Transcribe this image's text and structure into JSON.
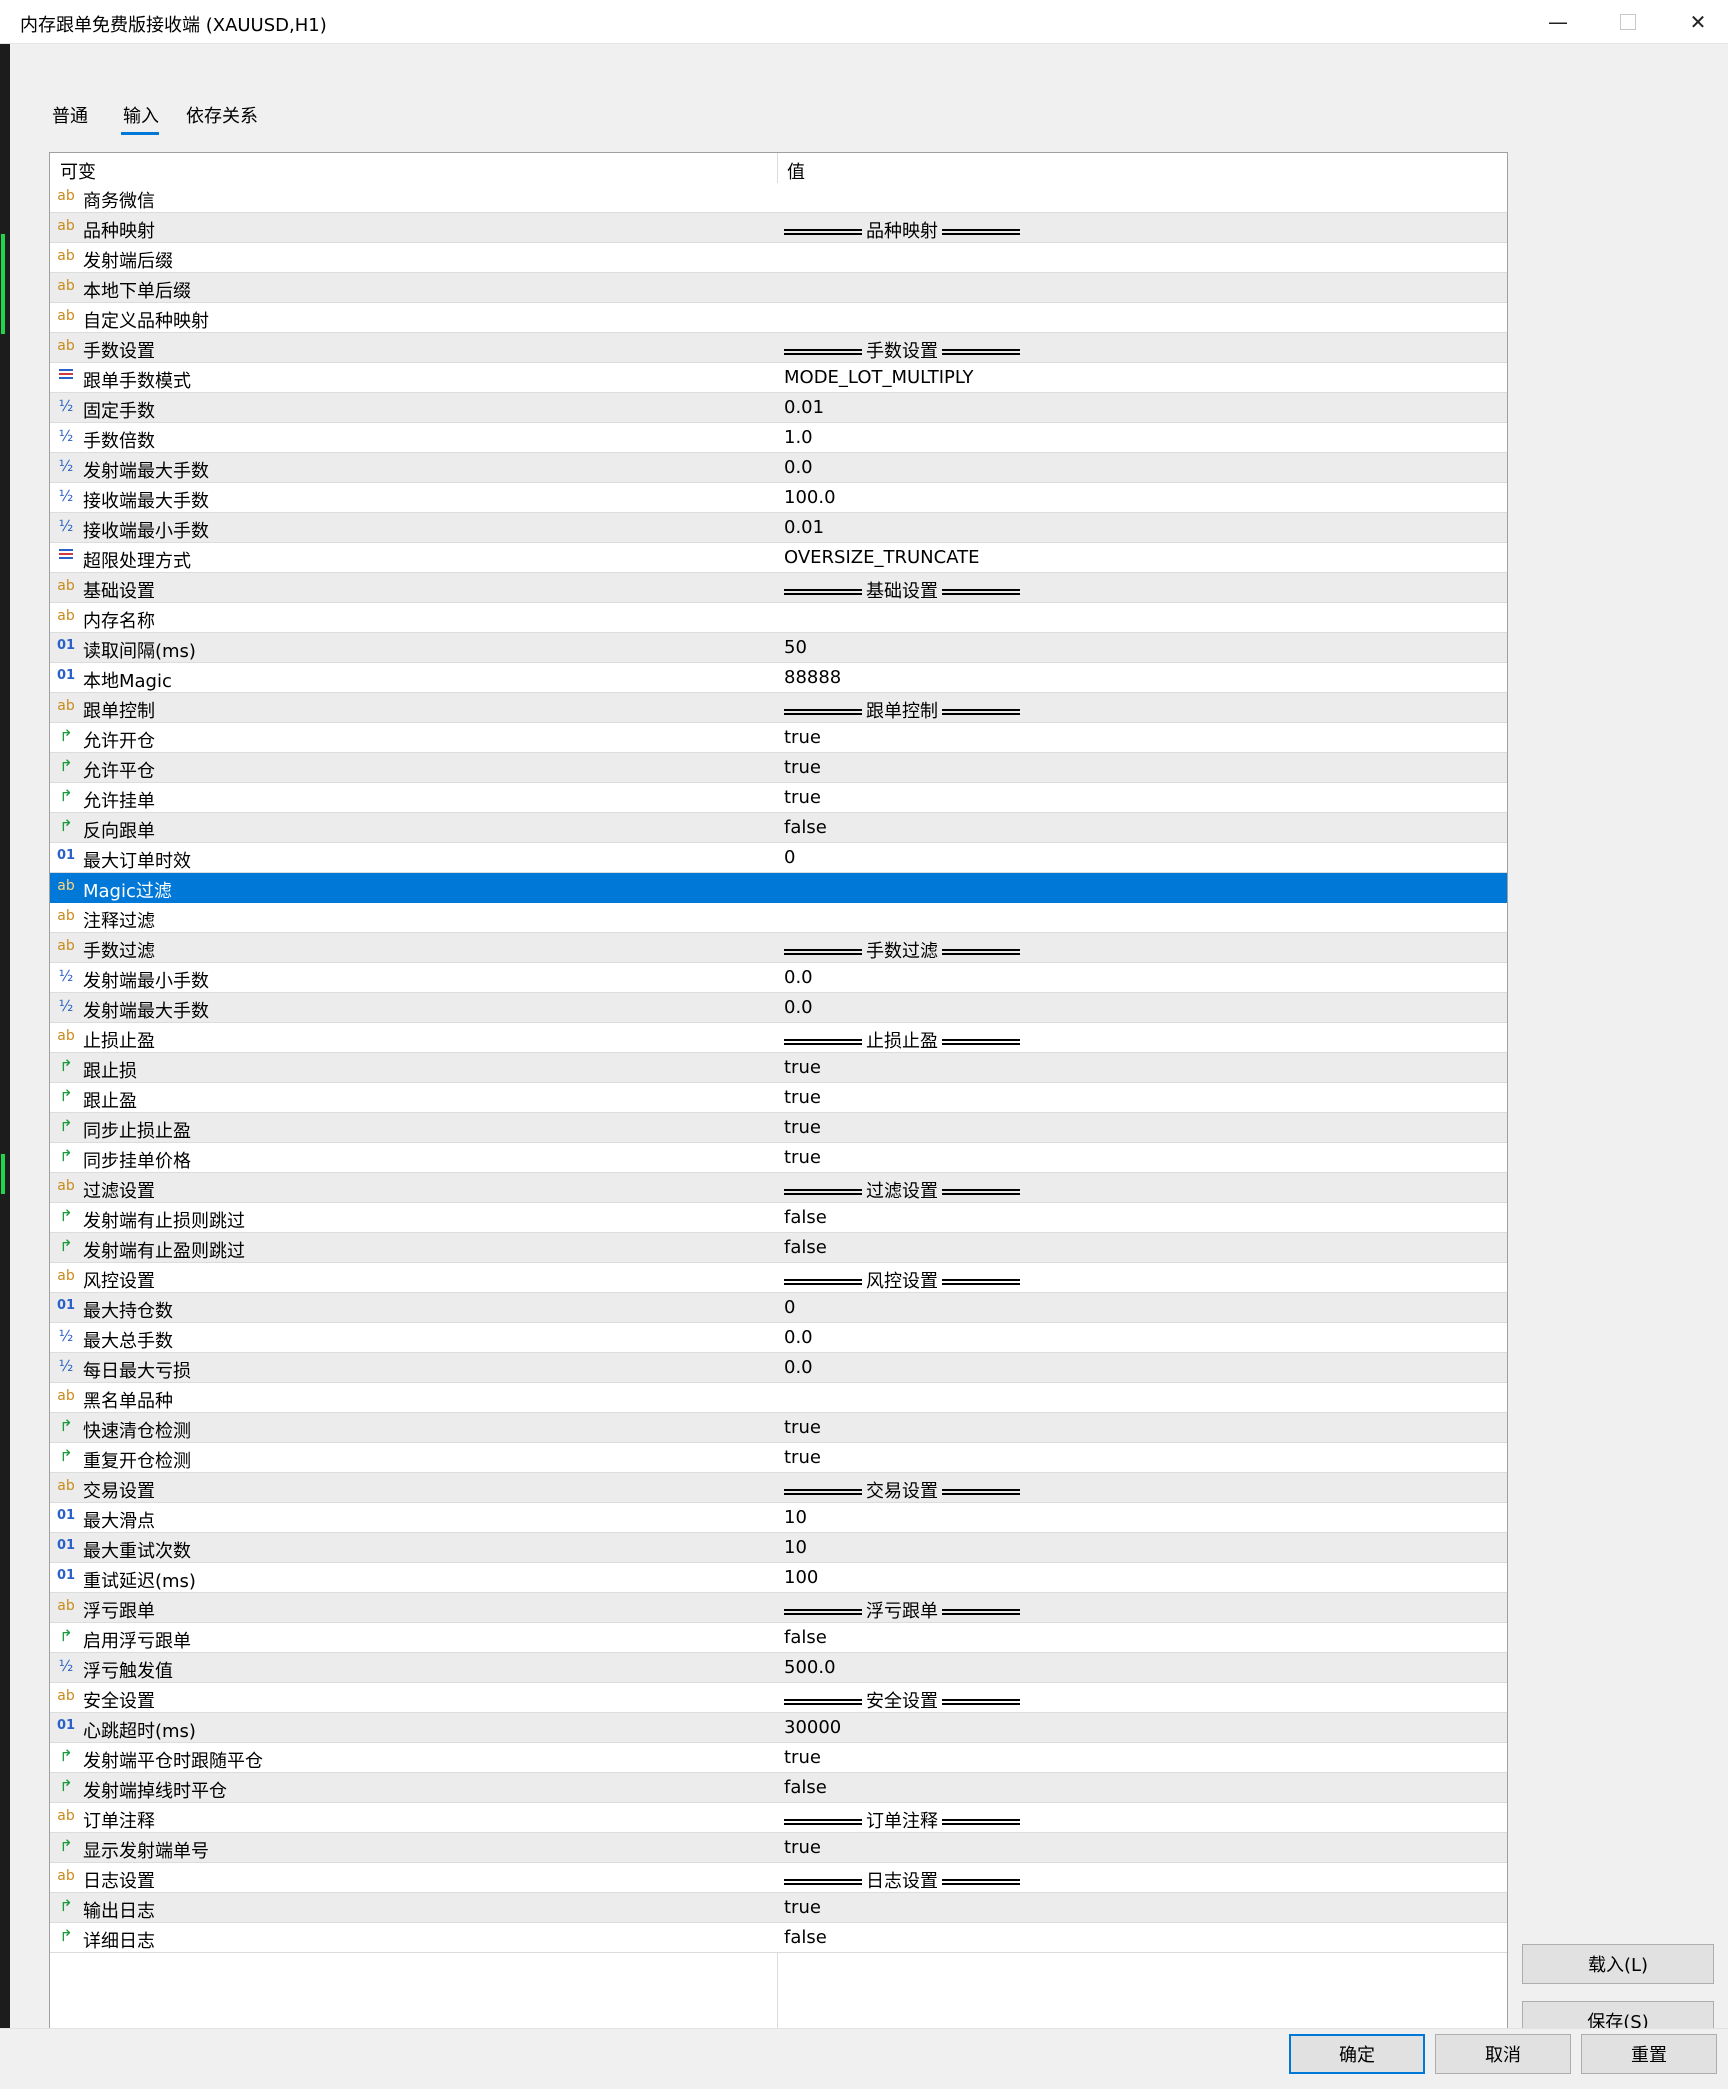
{
  "window": {
    "title": "内存跟单免费版接收端 (XAUUSD,H1)",
    "minimize": "—",
    "close": "✕"
  },
  "tabs": [
    {
      "label": "普通"
    },
    {
      "label": "输入"
    },
    {
      "label": "依存关系"
    }
  ],
  "grid": {
    "col_name": "可变",
    "col_value": "值",
    "rows": [
      {
        "type": "str",
        "name": "商务微信",
        "value": ""
      },
      {
        "type": "str",
        "name": "品种映射",
        "value": "品种映射",
        "section": true
      },
      {
        "type": "str",
        "name": "发射端后缀",
        "value": ""
      },
      {
        "type": "str",
        "name": "本地下单后缀",
        "value": ""
      },
      {
        "type": "str",
        "name": "自定义品种映射",
        "value": ""
      },
      {
        "type": "str",
        "name": "手数设置",
        "value": "手数设置",
        "section": true
      },
      {
        "type": "enum",
        "name": "跟单手数模式",
        "value": "MODE_LOT_MULTIPLY"
      },
      {
        "type": "frac",
        "name": "固定手数",
        "value": "0.01"
      },
      {
        "type": "frac",
        "name": "手数倍数",
        "value": "1.0"
      },
      {
        "type": "frac",
        "name": "发射端最大手数",
        "value": "0.0"
      },
      {
        "type": "frac",
        "name": "接收端最大手数",
        "value": "100.0"
      },
      {
        "type": "frac",
        "name": "接收端最小手数",
        "value": "0.01"
      },
      {
        "type": "enum",
        "name": "超限处理方式",
        "value": "OVERSIZE_TRUNCATE"
      },
      {
        "type": "str",
        "name": "基础设置",
        "value": "基础设置",
        "section": true
      },
      {
        "type": "str",
        "name": "内存名称",
        "value": ""
      },
      {
        "type": "num",
        "name": "读取间隔(ms)",
        "value": "50"
      },
      {
        "type": "num",
        "name": "本地Magic",
        "value": "88888"
      },
      {
        "type": "str",
        "name": "跟单控制",
        "value": "跟单控制",
        "section": true
      },
      {
        "type": "bool",
        "name": "允许开仓",
        "value": "true"
      },
      {
        "type": "bool",
        "name": "允许平仓",
        "value": "true"
      },
      {
        "type": "bool",
        "name": "允许挂单",
        "value": "true"
      },
      {
        "type": "bool",
        "name": "反向跟单",
        "value": "false"
      },
      {
        "type": "num",
        "name": "最大订单时效",
        "value": "0"
      },
      {
        "type": "str",
        "name": "Magic过滤",
        "value": "",
        "selected": true
      },
      {
        "type": "str",
        "name": "注释过滤",
        "value": ""
      },
      {
        "type": "str",
        "name": "手数过滤",
        "value": "手数过滤",
        "section": true
      },
      {
        "type": "frac",
        "name": "发射端最小手数",
        "value": "0.0"
      },
      {
        "type": "frac",
        "name": "发射端最大手数",
        "value": "0.0"
      },
      {
        "type": "str",
        "name": "止损止盈",
        "value": "止损止盈",
        "section": true
      },
      {
        "type": "bool",
        "name": "跟止损",
        "value": "true"
      },
      {
        "type": "bool",
        "name": "跟止盈",
        "value": "true"
      },
      {
        "type": "bool",
        "name": "同步止损止盈",
        "value": "true"
      },
      {
        "type": "bool",
        "name": "同步挂单价格",
        "value": "true"
      },
      {
        "type": "str",
        "name": "过滤设置",
        "value": "过滤设置",
        "section": true
      },
      {
        "type": "bool",
        "name": "发射端有止损则跳过",
        "value": "false"
      },
      {
        "type": "bool",
        "name": "发射端有止盈则跳过",
        "value": "false"
      },
      {
        "type": "str",
        "name": "风控设置",
        "value": "风控设置",
        "section": true
      },
      {
        "type": "num",
        "name": "最大持仓数",
        "value": "0"
      },
      {
        "type": "frac",
        "name": "最大总手数",
        "value": "0.0"
      },
      {
        "type": "frac",
        "name": "每日最大亏损",
        "value": "0.0"
      },
      {
        "type": "str",
        "name": "黑名单品种",
        "value": ""
      },
      {
        "type": "bool",
        "name": "快速清仓检测",
        "value": "true"
      },
      {
        "type": "bool",
        "name": "重复开仓检测",
        "value": "true"
      },
      {
        "type": "str",
        "name": "交易设置",
        "value": "交易设置",
        "section": true
      },
      {
        "type": "num",
        "name": "最大滑点",
        "value": "10"
      },
      {
        "type": "num",
        "name": "最大重试次数",
        "value": "10"
      },
      {
        "type": "num",
        "name": "重试延迟(ms)",
        "value": "100"
      },
      {
        "type": "str",
        "name": "浮亏跟单",
        "value": "浮亏跟单",
        "section": true
      },
      {
        "type": "bool",
        "name": "启用浮亏跟单",
        "value": "false"
      },
      {
        "type": "frac",
        "name": "浮亏触发值",
        "value": "500.0"
      },
      {
        "type": "str",
        "name": "安全设置",
        "value": "安全设置",
        "section": true
      },
      {
        "type": "num",
        "name": "心跳超时(ms)",
        "value": "30000"
      },
      {
        "type": "bool",
        "name": "发射端平仓时跟随平仓",
        "value": "true"
      },
      {
        "type": "bool",
        "name": "发射端掉线时平仓",
        "value": "false"
      },
      {
        "type": "str",
        "name": "订单注释",
        "value": "订单注释",
        "section": true
      },
      {
        "type": "bool",
        "name": "显示发射端单号",
        "value": "true"
      },
      {
        "type": "str",
        "name": "日志设置",
        "value": "日志设置",
        "section": true
      },
      {
        "type": "bool",
        "name": "输出日志",
        "value": "true"
      },
      {
        "type": "bool",
        "name": "详细日志",
        "value": "false"
      }
    ]
  },
  "icons": {
    "str": "ab",
    "num": "01",
    "frac": "½",
    "bool": "↱",
    "enum": "list-icon"
  },
  "buttons": {
    "load": "载入(L)",
    "save": "保存(S)",
    "ok": "确定",
    "cancel": "取消",
    "reset": "重置"
  },
  "colors": {
    "selection": "#0078d7",
    "accent": "#0078d7"
  }
}
